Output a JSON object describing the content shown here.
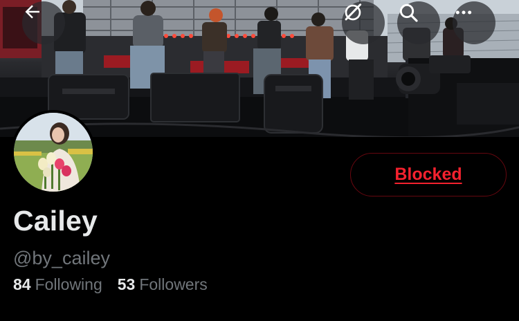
{
  "header": {
    "icons": {
      "back": "arrow-left-icon",
      "grok": "grok-icon",
      "search": "search-icon",
      "more": "more-horizontal-icon"
    }
  },
  "banner": {
    "description_icon": "concert-stage-photo"
  },
  "profile": {
    "display_name": "Cailey",
    "handle": "@by_cailey",
    "action_button": {
      "label": "Blocked",
      "color": "#f4212e",
      "border_color": "#67070f"
    },
    "stats": [
      {
        "value": "84",
        "label": "Following"
      },
      {
        "value": "53",
        "label": "Followers"
      }
    ]
  },
  "colors": {
    "background": "#000000",
    "primary_text": "#e7e9ea",
    "secondary_text": "#71767b",
    "danger": "#f4212e"
  }
}
